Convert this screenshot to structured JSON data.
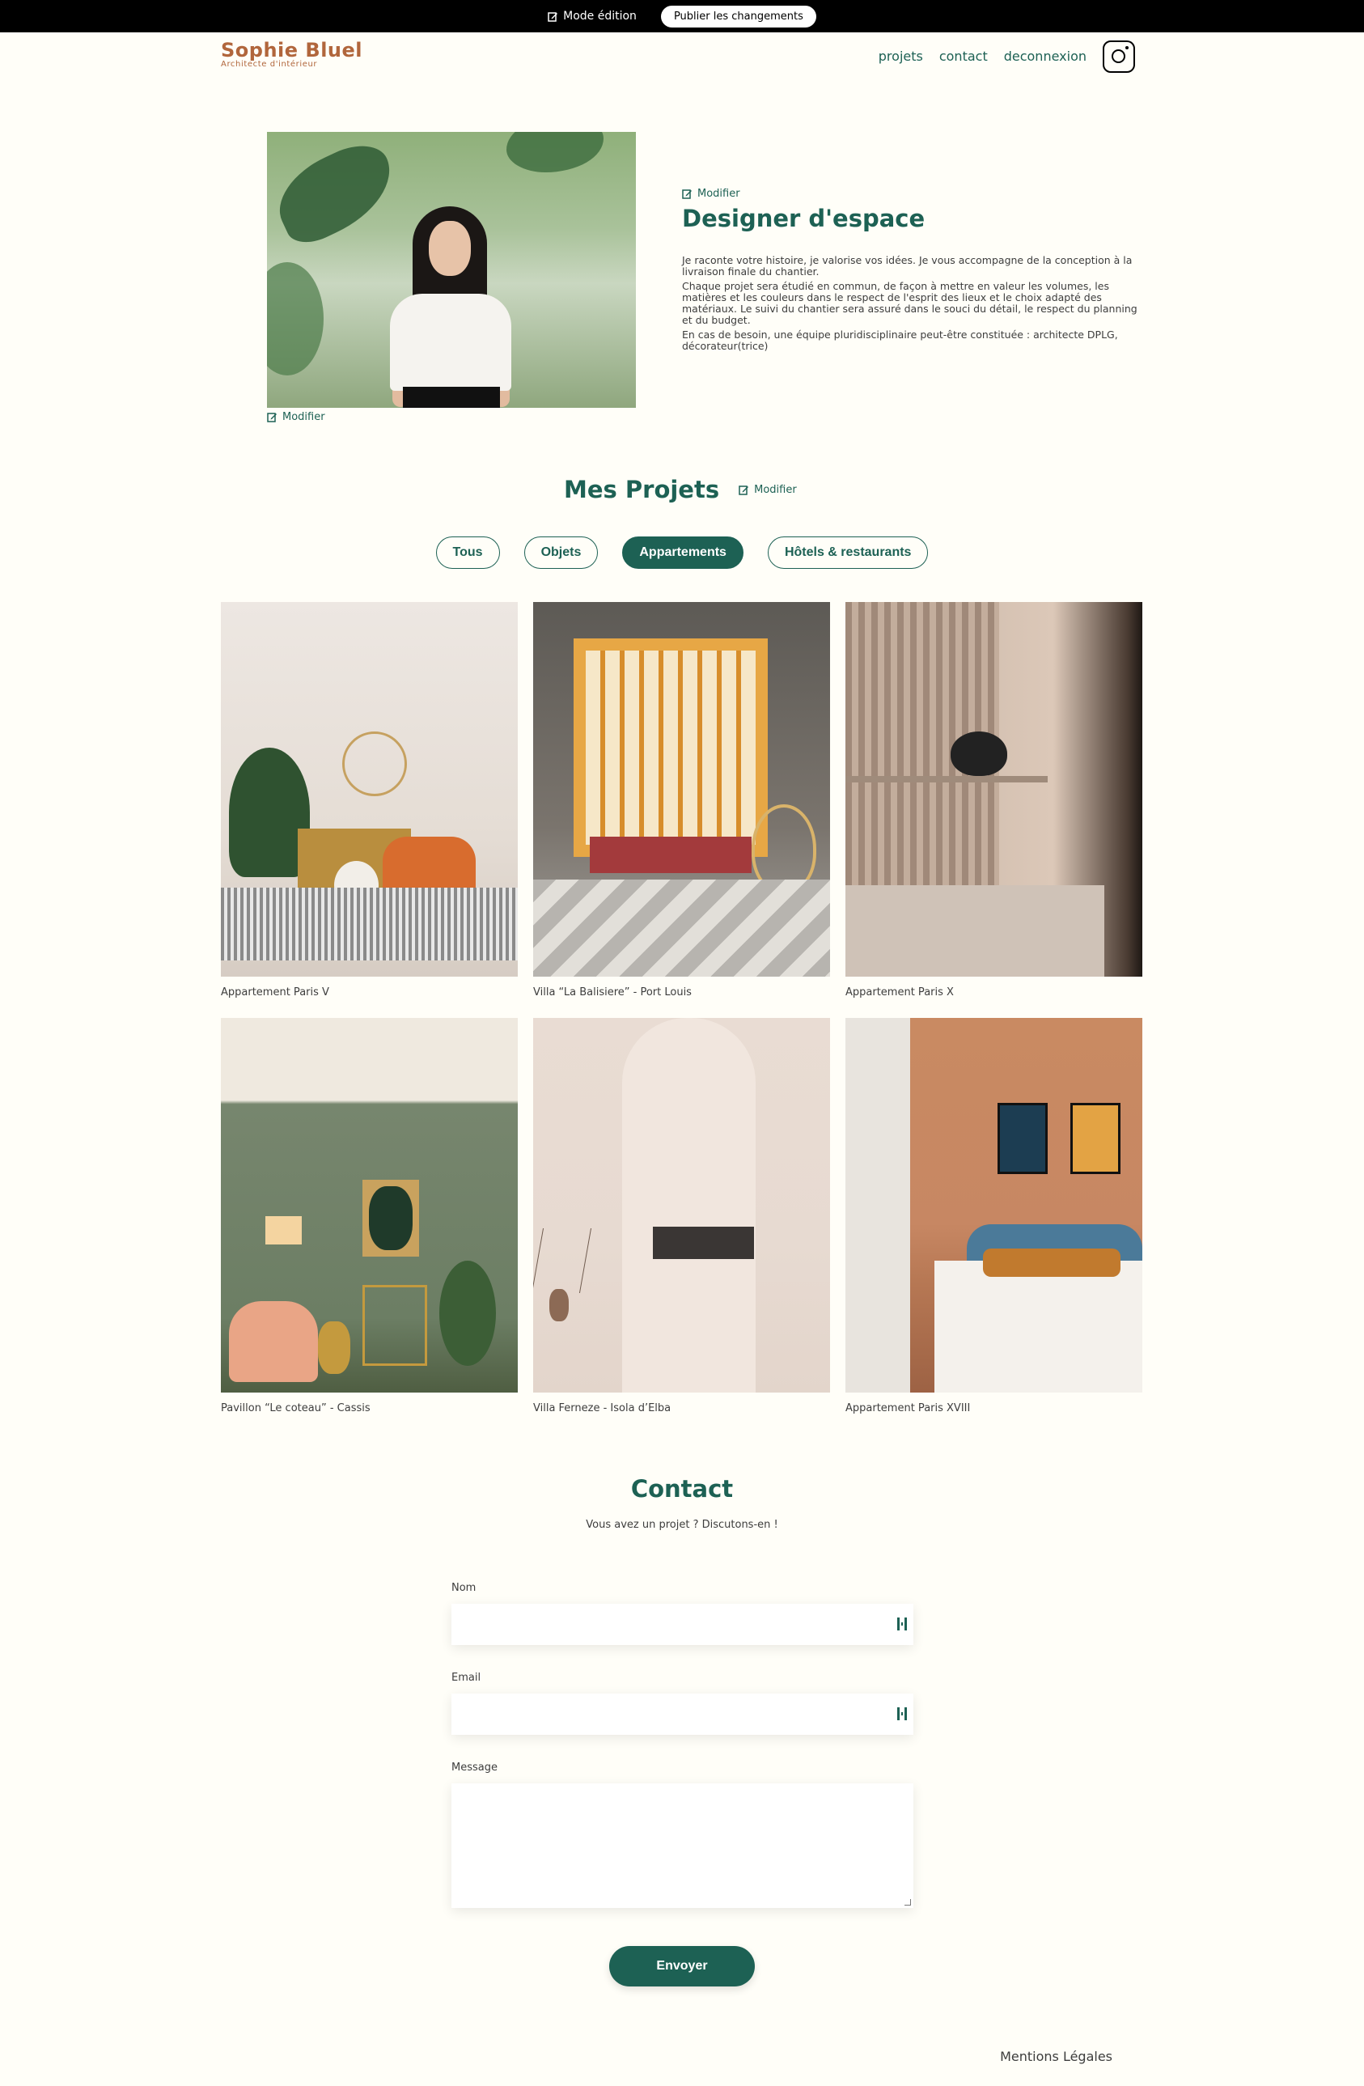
{
  "edit_bar": {
    "mode_label": "Mode édition",
    "publish_label": "Publier les changements"
  },
  "header": {
    "logo_name": "Sophie Bluel",
    "logo_sub": "Architecte d'intérieur",
    "nav": [
      "projets",
      "contact",
      "deconnexion"
    ],
    "instagram_icon": "instagram-icon"
  },
  "intro": {
    "photo_modify": "Modifier",
    "text_modify": "Modifier",
    "title": "Designer d'espace",
    "p1": "Je raconte votre histoire, je valorise vos idées. Je vous accompagne de la conception à la livraison finale du chantier.",
    "p2": "Chaque projet sera étudié en commun, de façon à mettre en valeur les volumes, les matières et les couleurs dans le respect de l'esprit des lieux et le choix adapté des matériaux. Le suivi du chantier sera assuré dans le souci du détail, le respect du planning et du budget.",
    "p3": "En cas de besoin, une équipe pluridisciplinaire peut-être constituée : architecte DPLG, décorateur(trice)"
  },
  "projects": {
    "title": "Mes Projets",
    "modify": "Modifier",
    "filters": [
      "Tous",
      "Objets",
      "Appartements",
      "Hôtels & restaurants"
    ],
    "active_filter": "Appartements",
    "items": [
      {
        "caption": "Appartement Paris V"
      },
      {
        "caption": "Villa “La Balisiere” - Port Louis"
      },
      {
        "caption": "Appartement Paris X"
      },
      {
        "caption": "Pavillon “Le coteau” - Cassis"
      },
      {
        "caption": "Villa Ferneze - Isola d’Elba"
      },
      {
        "caption": "Appartement Paris XVIII"
      }
    ]
  },
  "contact": {
    "title": "Contact",
    "lead": "Vous avez un projet ? Discutons-en !",
    "name_label": "Nom",
    "email_label": "Email",
    "message_label": "Message",
    "send_label": "Envoyer"
  },
  "footer": {
    "legal": "Mentions Légales"
  },
  "colors": {
    "accent": "#1D6154",
    "brand": "#B1663C",
    "background": "#FFFEF8"
  }
}
